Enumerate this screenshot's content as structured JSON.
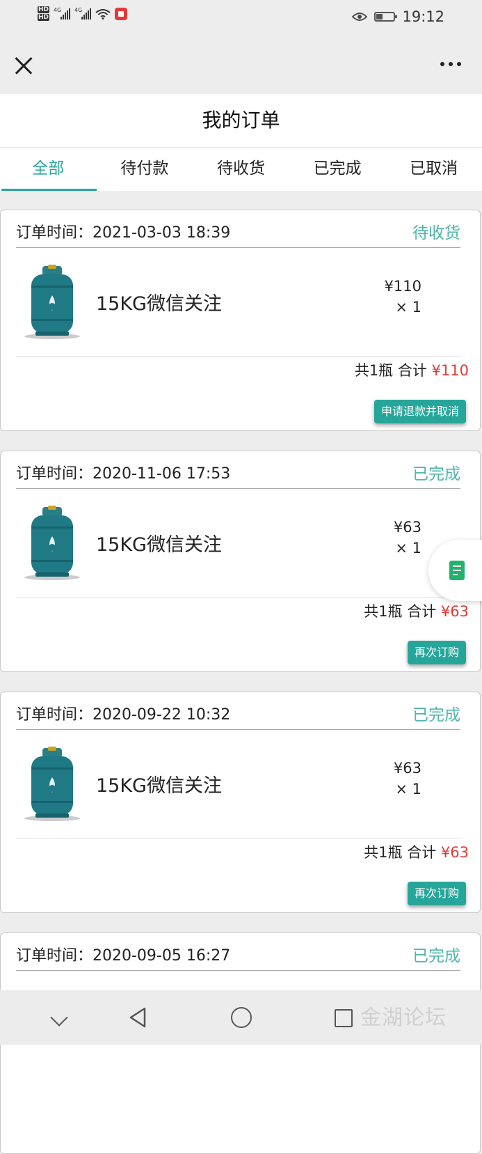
{
  "status_bar": {
    "left_icons": [
      "hd-icon",
      "signal-4g-icon",
      "signal-4g-icon",
      "wifi-icon",
      "notification-icon"
    ],
    "network_label": "4G",
    "time": "19:12"
  },
  "navbar": {
    "close_icon": "close-icon",
    "more_icon": "more-icon"
  },
  "header": {
    "title": "我的订单"
  },
  "tabs": [
    {
      "label": "全部",
      "active": true
    },
    {
      "label": "待付款",
      "active": false
    },
    {
      "label": "待收货",
      "active": false
    },
    {
      "label": "已完成",
      "active": false
    },
    {
      "label": "已取消",
      "active": false
    }
  ],
  "orders": [
    {
      "time": "订单时间：2021-03-03 18:39",
      "status": "待收货",
      "product_name": "15KG微信关注",
      "price": "¥110",
      "qty": "× 1",
      "total_prefix": "共1瓶  合计",
      "total_amount": "¥110",
      "action": "申请退款并取消"
    },
    {
      "time": "订单时间：2020-11-06 17:53",
      "status": "已完成",
      "product_name": "15KG微信关注",
      "price": "¥63",
      "qty": "× 1",
      "total_prefix": "共1瓶  合计",
      "total_amount": "¥63",
      "action": "再次订购"
    },
    {
      "time": "订单时间：2020-09-22 10:32",
      "status": "已完成",
      "product_name": "15KG微信关注",
      "price": "¥63",
      "qty": "× 1",
      "total_prefix": "共1瓶  合计",
      "total_amount": "¥63",
      "action": "再次订购"
    },
    {
      "time": "订单时间：2020-09-05 16:27",
      "status": "已完成"
    }
  ],
  "floating_button": {
    "icon": "document-icon"
  },
  "system_nav": [
    "chevron-down-icon",
    "back-icon",
    "home-icon",
    "recent-apps-icon"
  ],
  "watermark": "金湖论坛",
  "colors": {
    "accent": "#26a69a",
    "status_text": "#4db6ac",
    "price_red": "#e53935",
    "background": "#ededed"
  }
}
